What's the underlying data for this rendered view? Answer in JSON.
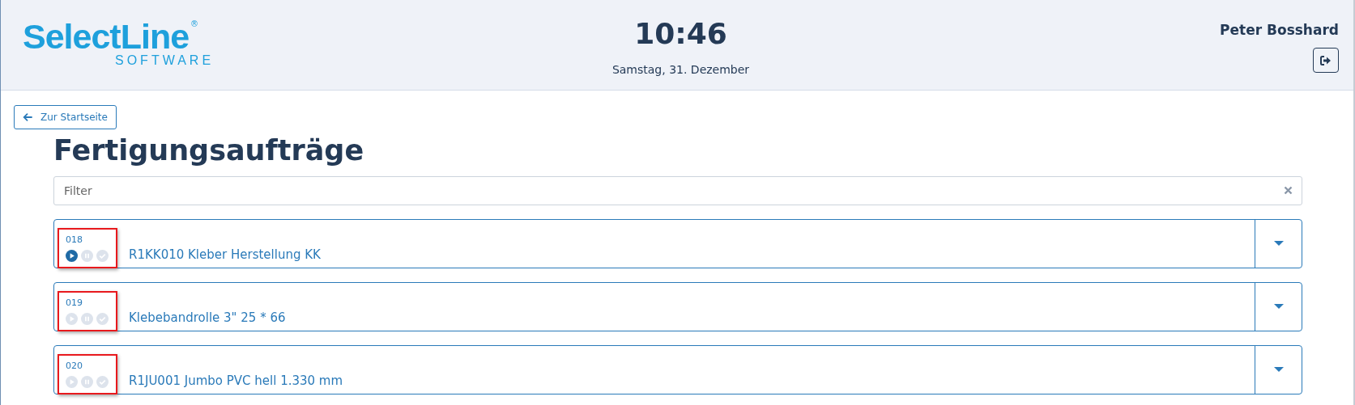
{
  "header": {
    "logo": {
      "name": "SelectLine",
      "mark": "®",
      "tagline": "SOFTWARE"
    },
    "time": "10:46",
    "date": "Samstag, 31. Dezember",
    "user": "Peter Bosshard"
  },
  "back_link": {
    "label": "Zur Startseite"
  },
  "title": "Fertigungsaufträge",
  "filter": {
    "placeholder": "Filter"
  },
  "orders": [
    {
      "number": "018",
      "name": "R1KK010 Kleber Herstellung KK",
      "highlighted": true,
      "actions": [
        {
          "kind": "start",
          "active": true
        },
        {
          "kind": "pause",
          "active": false
        },
        {
          "kind": "finish",
          "active": false
        }
      ]
    },
    {
      "number": "019",
      "name": "Klebebandrolle 3\" 25 * 66",
      "highlighted": true,
      "actions": [
        {
          "kind": "start",
          "active": false
        },
        {
          "kind": "pause",
          "active": false
        },
        {
          "kind": "finish",
          "active": false
        }
      ]
    },
    {
      "number": "020",
      "name": "R1JU001 Jumbo PVC hell 1.330 mm",
      "highlighted": true,
      "actions": [
        {
          "kind": "start",
          "active": false
        },
        {
          "kind": "pause",
          "active": false
        },
        {
          "kind": "finish",
          "active": false
        }
      ]
    }
  ]
}
